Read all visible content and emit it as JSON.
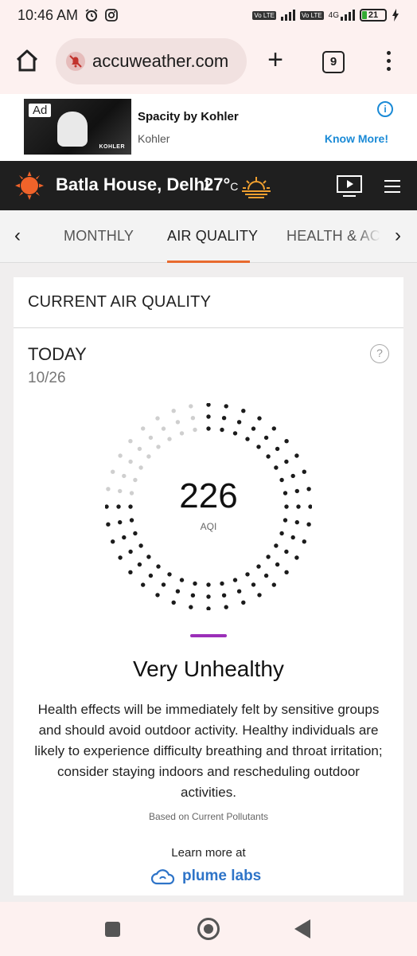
{
  "status_bar": {
    "time": "10:46 AM",
    "network": "4G",
    "volte_label": "Vo LTE",
    "battery": "21"
  },
  "browser": {
    "url": "accuweather.com",
    "tab_count": "9"
  },
  "ad": {
    "badge": "Ad",
    "title": "Spacity by Kohler",
    "advertiser": "Kohler",
    "cta": "Know More!",
    "image_brand": "KOHLER"
  },
  "header": {
    "location": "Batla House, Delhi",
    "temperature": "27°",
    "unit": "C"
  },
  "subnav": {
    "tabs": [
      {
        "label": "MONTHLY"
      },
      {
        "label": "AIR QUALITY"
      },
      {
        "label": "HEALTH & ACT"
      }
    ],
    "active_index": 1
  },
  "air_quality": {
    "card_title": "CURRENT AIR QUALITY",
    "day_label": "TODAY",
    "date": "10/26",
    "help_symbol": "?",
    "aqi_value": "226",
    "aqi_label": "AQI",
    "aqi_scale_max": 300,
    "category": "Very Unhealthy",
    "category_color": "#9b2fb8",
    "description": "Health effects will be immediately felt by sensitive groups and should avoid outdoor activity. Healthy individuals are likely to experience difficulty breathing and throat irritation; consider staying indoors and rescheduling outdoor activities.",
    "based_on": "Based on Current Pollutants",
    "learn_more": "Learn more at",
    "partner": "plume labs"
  },
  "colors": {
    "accent": "#e86a2e",
    "link": "#1a8ad6",
    "header_bg": "#1f1f1f",
    "plume": "#2e74c8"
  }
}
